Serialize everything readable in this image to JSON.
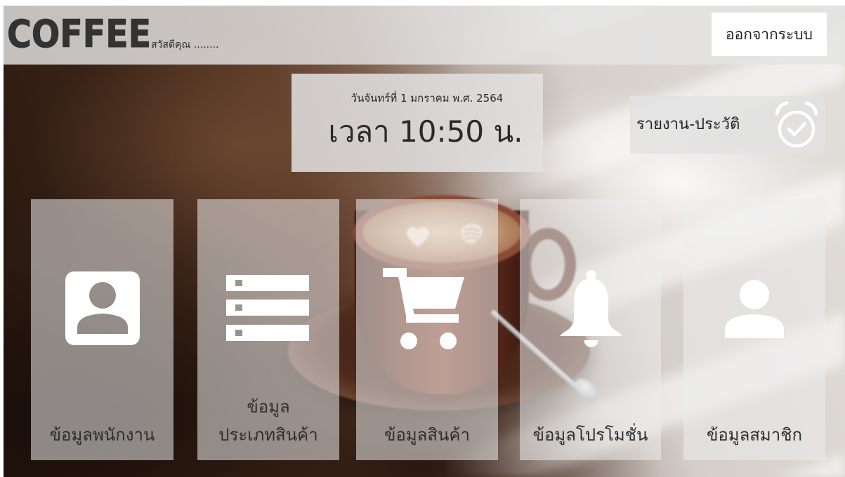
{
  "app": {
    "logo": "COFFEE",
    "greeting": "สวัสดีคุณ ........"
  },
  "header": {
    "logout_label": "ออกจากระบบ"
  },
  "clock": {
    "date": "วันจันทร์ที่ 1 มกราคม พ.ศ. 2564",
    "time": "เวลา 10:50 น."
  },
  "report": {
    "label": "รายงาน-ประวัติ",
    "icon": "alarm-check-icon"
  },
  "menu": {
    "items": [
      {
        "label_lines": [
          "ข้อมูลพนักงาน"
        ],
        "icon": "contact-card-icon"
      },
      {
        "label_lines": [
          "ข้อมูล",
          "ประเภทสินค้า"
        ],
        "icon": "list-icon"
      },
      {
        "label_lines": [
          "ข้อมูลสินค้า"
        ],
        "icon": "shopping-cart-icon"
      },
      {
        "label_lines": [
          "ข้อมูลโปรโมชั่น"
        ],
        "icon": "bell-icon"
      },
      {
        "label_lines": [
          "ข้อมูลสมาชิก"
        ],
        "icon": "person-icon"
      }
    ]
  },
  "colors": {
    "logo": "#333333",
    "icon": "#ffffff",
    "label_text": "#2e2e2e",
    "logout_button_bg": "#ffffff"
  }
}
